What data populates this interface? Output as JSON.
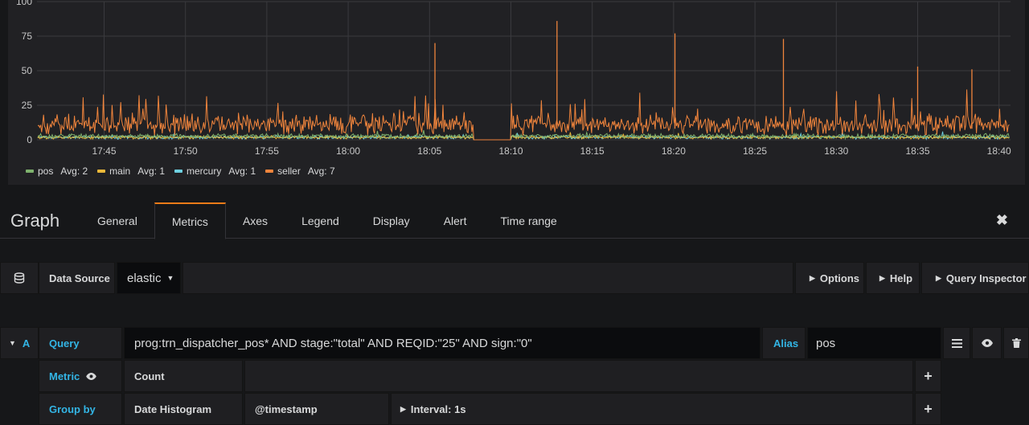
{
  "chart_data": {
    "type": "line",
    "y_ticks": [
      "100",
      "75",
      "50",
      "25",
      "0"
    ],
    "ylim": [
      0,
      100
    ],
    "x_ticks": [
      "17:45",
      "17:50",
      "17:55",
      "18:00",
      "18:05",
      "18:10",
      "18:15",
      "18:20",
      "18:25",
      "18:30",
      "18:35",
      "18:40"
    ],
    "grid": true,
    "legend_position": "bottom-left",
    "series": [
      {
        "name": "pos",
        "avg_label": "Avg: 2",
        "color": "#7eb26d",
        "typical": 2
      },
      {
        "name": "main",
        "avg_label": "Avg: 1",
        "color": "#eab839",
        "typical": 1
      },
      {
        "name": "mercury",
        "avg_label": "Avg: 1",
        "color": "#6ed0e0",
        "typical": 1
      },
      {
        "name": "seller",
        "avg_label": "Avg: 7",
        "color": "#ef843c",
        "typical": 7,
        "gap": [
          "18:07:40",
          "18:10:00"
        ],
        "peaks": [
          {
            "t": "18:05:20",
            "v": 70
          },
          {
            "t": "18:12:50",
            "v": 86
          },
          {
            "t": "18:20:05",
            "v": 77
          },
          {
            "t": "18:26:45",
            "v": 73
          },
          {
            "t": "18:35:00",
            "v": 53
          },
          {
            "t": "18:38:20",
            "v": 51
          }
        ]
      }
    ]
  },
  "editor": {
    "title": "Graph",
    "tabs": [
      "General",
      "Metrics",
      "Axes",
      "Legend",
      "Display",
      "Alert",
      "Time range"
    ],
    "active_tab": "Metrics",
    "close_icon": "✖"
  },
  "datasource": {
    "icon": "database-icon",
    "label": "Data Source",
    "value": "elastic",
    "options_label": "Options",
    "help_label": "Help",
    "inspector_label": "Query Inspector"
  },
  "query": {
    "ref_id": "A",
    "query_label": "Query",
    "query_value": "prog:trn_dispatcher_pos*  AND stage:\"total\" AND REQID:\"25\" AND sign:\"0\"",
    "alias_label": "Alias",
    "alias_value": "pos",
    "metric_label": "Metric",
    "metric_value": "Count",
    "groupby_label": "Group by",
    "groupby_type": "Date Histogram",
    "groupby_field": "@timestamp",
    "groupby_interval": "Interval: 1s",
    "add_symbol": "+"
  }
}
